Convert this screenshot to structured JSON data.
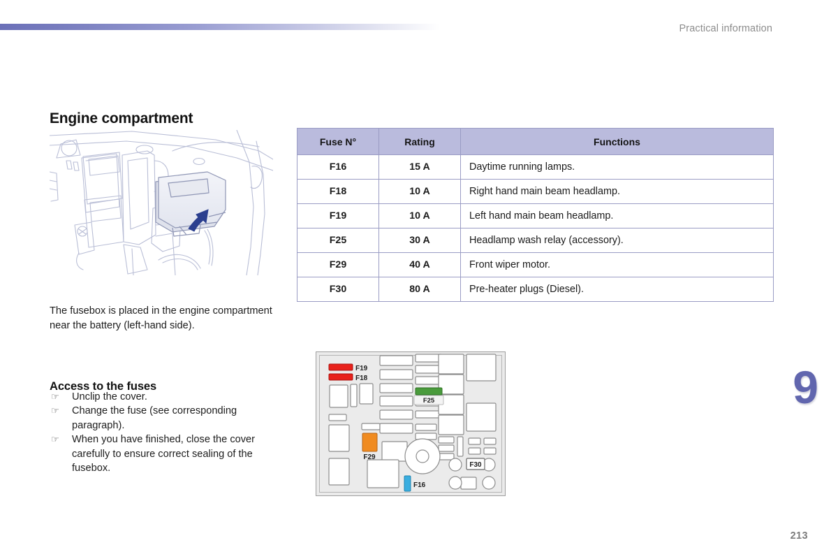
{
  "header": {
    "title": "Practical information",
    "rule_color_start": "#6b70b8",
    "rule_color_end": "#ffffff"
  },
  "section": {
    "title": "Engine compartment",
    "caption": "The fusebox is placed in the engine compartment near the battery (left-hand side)."
  },
  "access": {
    "title": "Access to the fuses",
    "bullet_glyph": "☞",
    "items": [
      "Unclip the cover.",
      "Change the fuse (see corresponding paragraph).",
      "When you have finished, close the cover carefully to ensure correct sealing of the fusebox."
    ]
  },
  "table": {
    "header_bg": "#babbdd",
    "border_color": "#9a9cc4",
    "columns": [
      "Fuse N°",
      "Rating",
      "Functions"
    ],
    "rows": [
      {
        "fuse": "F16",
        "rating": "15 A",
        "function": "Daytime running lamps."
      },
      {
        "fuse": "F18",
        "rating": "10 A",
        "function": "Right hand main beam headlamp."
      },
      {
        "fuse": "F19",
        "rating": "10 A",
        "function": "Left hand main beam headlamp."
      },
      {
        "fuse": "F25",
        "rating": "30 A",
        "function": "Headlamp wash relay (accessory)."
      },
      {
        "fuse": "F29",
        "rating": "40 A",
        "function": "Front wiper motor."
      },
      {
        "fuse": "F30",
        "rating": "80 A",
        "function": "Pre-heater plugs (Diesel)."
      }
    ]
  },
  "diagram": {
    "labels": {
      "f19": "F19",
      "f18": "F18",
      "f25": "F25",
      "f29": "F29",
      "f16": "F16",
      "f30": "F30"
    },
    "fuse_colors": {
      "f19": "#e8211b",
      "f18": "#e8211b",
      "f25": "#4a9b3c",
      "f29": "#f08b20",
      "f16": "#3aaee0"
    },
    "board_bg": "#ebebeb",
    "board_border": "#9e9e9e"
  },
  "illustration": {
    "line_color": "#b9bed6",
    "arrow_color": "#2b3f8f",
    "cover_fill": "#eceef5"
  },
  "footer": {
    "chapter": "9",
    "chapter_color": "#6166ae",
    "page": "213"
  }
}
